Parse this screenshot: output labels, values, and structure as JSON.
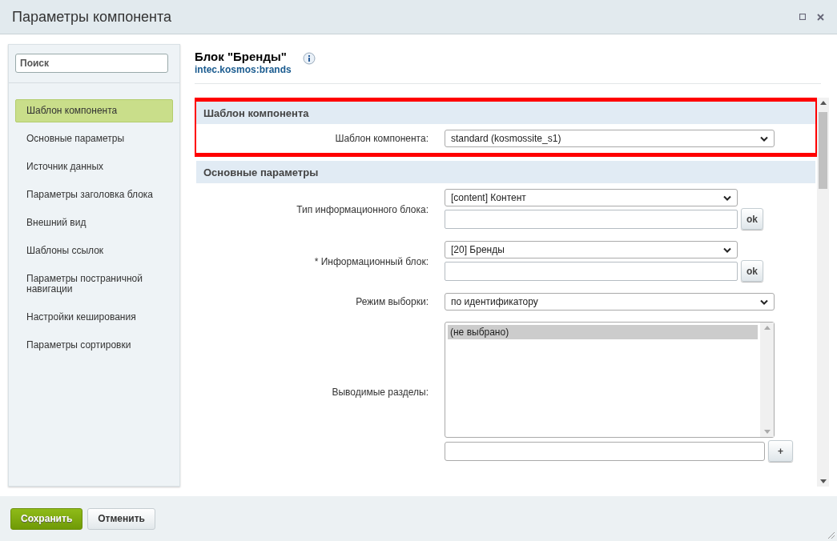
{
  "window": {
    "title": "Параметры компонента"
  },
  "sidebar": {
    "search": {
      "placeholder": "Поиск"
    },
    "items": [
      {
        "label": "Шаблон компонента",
        "selected": true
      },
      {
        "label": "Основные параметры",
        "selected": false
      },
      {
        "label": "Источник данных",
        "selected": false
      },
      {
        "label": "Параметры заголовка блока",
        "selected": false
      },
      {
        "label": "Внешний вид",
        "selected": false
      },
      {
        "label": "Шаблоны ссылок",
        "selected": false
      },
      {
        "label": "Параметры постраничной навигации",
        "selected": false
      },
      {
        "label": "Настройки кеширования",
        "selected": false
      },
      {
        "label": "Параметры сортировки",
        "selected": false
      }
    ]
  },
  "component": {
    "title": "Блок \"Бренды\"",
    "code": "intec.kosmos:brands"
  },
  "sections": [
    {
      "title": "Шаблон компонента",
      "highlighted": true,
      "fields": [
        {
          "kind": "select",
          "label": "Шаблон компонента:",
          "value": "standard (kosmossite_s1)"
        }
      ]
    },
    {
      "title": "Основные параметры",
      "highlighted": false,
      "fields": [
        {
          "kind": "lookup",
          "label": "Тип информационного блока:",
          "value": "[content] Контент",
          "button": "ok"
        },
        {
          "kind": "lookup",
          "label": "* Информационный блок:",
          "value": "[20] Бренды",
          "button": "ok"
        },
        {
          "kind": "select",
          "label": "Режим выборки:",
          "value": "по идентификатору"
        },
        {
          "kind": "multiselect",
          "label": "Выводимые разделы:",
          "options": [
            {
              "label": "(не выбрано)",
              "selected": true
            }
          ],
          "button": "+"
        }
      ]
    }
  ],
  "buttons": [
    {
      "label": "Сохранить",
      "kind": "primary"
    },
    {
      "label": "Отменить",
      "kind": "secondary"
    }
  ]
}
